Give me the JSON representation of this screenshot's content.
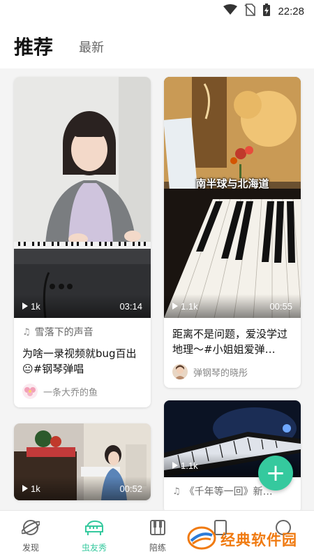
{
  "status_bar": {
    "time": "22:28"
  },
  "tabs": {
    "active": "推荐",
    "other": "最新"
  },
  "cards": [
    {
      "plays": "1k",
      "duration": "03:14",
      "song": "雪落下的声音",
      "title": "为啥一录视频就bug百出😐#钢琴弹唱",
      "author": "一条大乔的鱼"
    },
    {
      "plays": "1.1k",
      "duration": "00:55",
      "caption": "南半球与北海道",
      "title": "距离不是问题，爱没学过地理～#小姐姐爱弹…",
      "author": "弹钢琴的晓彤"
    },
    {
      "plays": "1k",
      "duration": "00:52"
    },
    {
      "plays": "1.1k",
      "song": "《千年等一回》新…"
    }
  ],
  "fab": {
    "label": "+"
  },
  "nav": [
    {
      "label": "发现",
      "icon": "discover-icon"
    },
    {
      "label": "虫友秀",
      "icon": "piano-icon"
    },
    {
      "label": "陪练",
      "icon": "keyboard-icon"
    }
  ],
  "watermark": {
    "text": "经典软件园"
  },
  "colors": {
    "accent": "#35c99e",
    "watermark": "#f07a10"
  }
}
